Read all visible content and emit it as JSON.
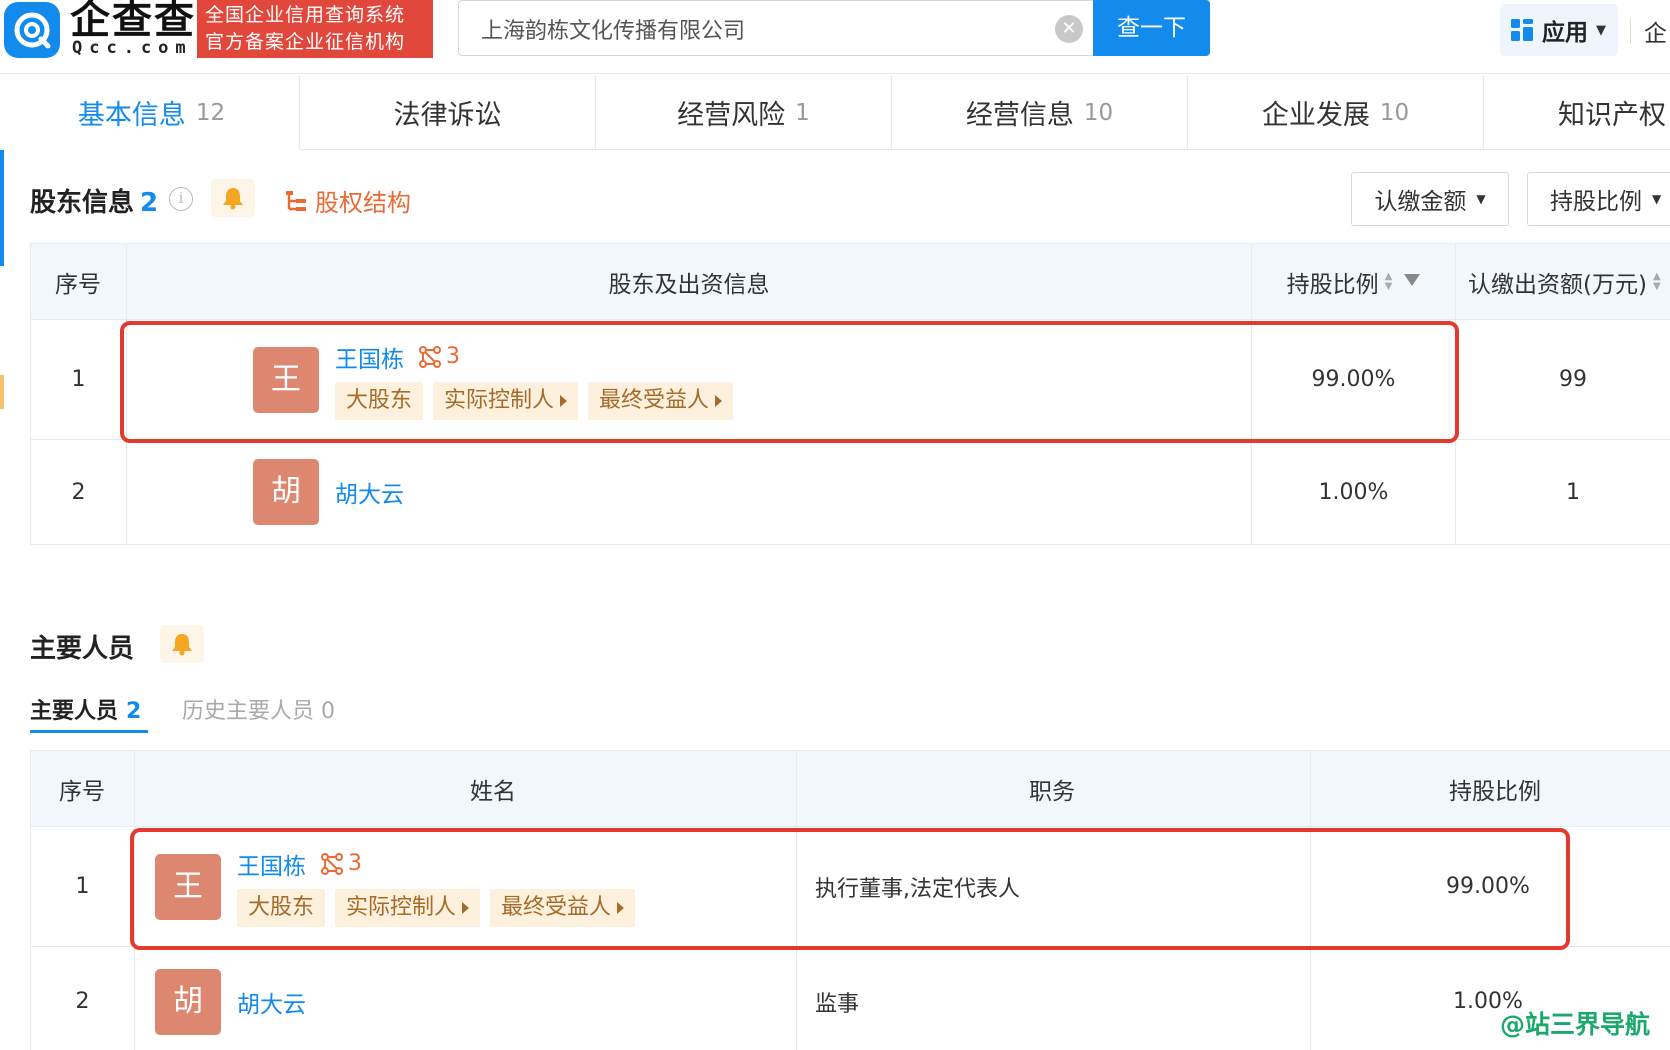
{
  "header": {
    "logo_name": "企查查",
    "logo_domain": "Qcc.com",
    "cert_line1": "全国企业信用查询系统",
    "cert_line2": "官方备案企业征信机构",
    "search_value": "上海韵栋文化传播有限公司",
    "search_button": "查一下",
    "apps_label": "应用",
    "extra": "企"
  },
  "tabs": [
    {
      "label": "基本信息",
      "count": "12"
    },
    {
      "label": "法律诉讼",
      "count": ""
    },
    {
      "label": "经营风险",
      "count": "1"
    },
    {
      "label": "经营信息",
      "count": "10"
    },
    {
      "label": "企业发展",
      "count": "10"
    },
    {
      "label": "知识产权",
      "count": ""
    }
  ],
  "shareholders": {
    "title": "股东信息",
    "count": "2",
    "equity_link": "股权结构",
    "dropdown_amount": "认缴金额",
    "dropdown_ratio": "持股比例",
    "columns": {
      "no": "序号",
      "info": "股东及出资信息",
      "ratio": "持股比例",
      "amount": "认缴出资额(万元)"
    },
    "rows": [
      {
        "no": "1",
        "avatar": "王",
        "name": "王国栋",
        "rel_count": "3",
        "tags": [
          "大股东",
          "实际控制人",
          "最终受益人"
        ],
        "ratio": "99.00%",
        "amount": "99"
      },
      {
        "no": "2",
        "avatar": "胡",
        "name": "胡大云",
        "ratio": "1.00%",
        "amount": "1"
      }
    ]
  },
  "personnel": {
    "title": "主要人员",
    "subtab_current": "主要人员",
    "subtab_current_count": "2",
    "subtab_history": "历史主要人员 0",
    "columns": {
      "no": "序号",
      "name": "姓名",
      "position": "职务",
      "ratio": "持股比例"
    },
    "rows": [
      {
        "no": "1",
        "avatar": "王",
        "name": "王国栋",
        "rel_count": "3",
        "tags": [
          "大股东",
          "实际控制人",
          "最终受益人"
        ],
        "position": "执行董事,法定代表人",
        "ratio": "99.00%"
      },
      {
        "no": "2",
        "avatar": "胡",
        "name": "胡大云",
        "position": "监事",
        "ratio": "1.00%"
      }
    ]
  },
  "watermark": "@站三界导航",
  "colors": {
    "brand": "#128bed",
    "highlight": "#e23a2e",
    "avatar": "#dd8771",
    "tag_bg": "#fdf1de"
  }
}
